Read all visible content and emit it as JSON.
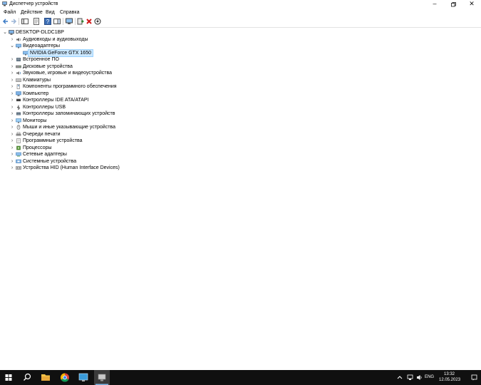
{
  "window": {
    "title": "Диспетчер устройств"
  },
  "menu": [
    "Файл",
    "Действие",
    "Вид",
    "Справка"
  ],
  "tree": {
    "root": "DESKTOP-DLDC1BP",
    "categories": [
      {
        "label": "Аудиовходы и аудиовыходы",
        "icon": "audio-io-icon"
      },
      {
        "label": "Видеоадаптеры",
        "icon": "display-adapter-icon",
        "expanded": true,
        "children": [
          {
            "label": "NVIDIA GeForce GTX 1650",
            "icon": "gpu-icon",
            "selected": true
          }
        ]
      },
      {
        "label": "Встроенное ПО",
        "icon": "firmware-icon"
      },
      {
        "label": "Дисковые устройства",
        "icon": "disk-drive-icon"
      },
      {
        "label": "Звуковые, игровые и видеоустройства",
        "icon": "sound-device-icon"
      },
      {
        "label": "Клавиатуры",
        "icon": "keyboard-icon"
      },
      {
        "label": "Компоненты программного обеспечения",
        "icon": "software-component-icon"
      },
      {
        "label": "Компьютер",
        "icon": "computer-icon"
      },
      {
        "label": "Контроллеры IDE ATA/ATAPI",
        "icon": "ide-controller-icon"
      },
      {
        "label": "Контроллеры USB",
        "icon": "usb-controller-icon"
      },
      {
        "label": "Контроллеры запоминающих устройств",
        "icon": "storage-controller-icon"
      },
      {
        "label": "Мониторы",
        "icon": "monitor-icon"
      },
      {
        "label": "Мыши и иные указывающие устройства",
        "icon": "mouse-icon"
      },
      {
        "label": "Очереди печати",
        "icon": "print-queue-icon"
      },
      {
        "label": "Программные устройства",
        "icon": "software-device-icon"
      },
      {
        "label": "Процессоры",
        "icon": "processor-icon"
      },
      {
        "label": "Сетевые адаптеры",
        "icon": "network-adapter-icon"
      },
      {
        "label": "Системные устройства",
        "icon": "system-device-icon"
      },
      {
        "label": "Устройства HID (Human Interface Devices)",
        "icon": "hid-icon"
      }
    ]
  },
  "taskbar": {
    "apps": [
      "start-icon",
      "search-icon",
      "file-explorer-icon",
      "chrome-icon",
      "remote-desktop-icon",
      "device-manager-icon"
    ]
  },
  "tray": {
    "lang": "ENG",
    "time": "13:32",
    "date": "12.05.2023"
  },
  "colors": {
    "selection": "#cce8ff",
    "taskbar": "#101010"
  }
}
